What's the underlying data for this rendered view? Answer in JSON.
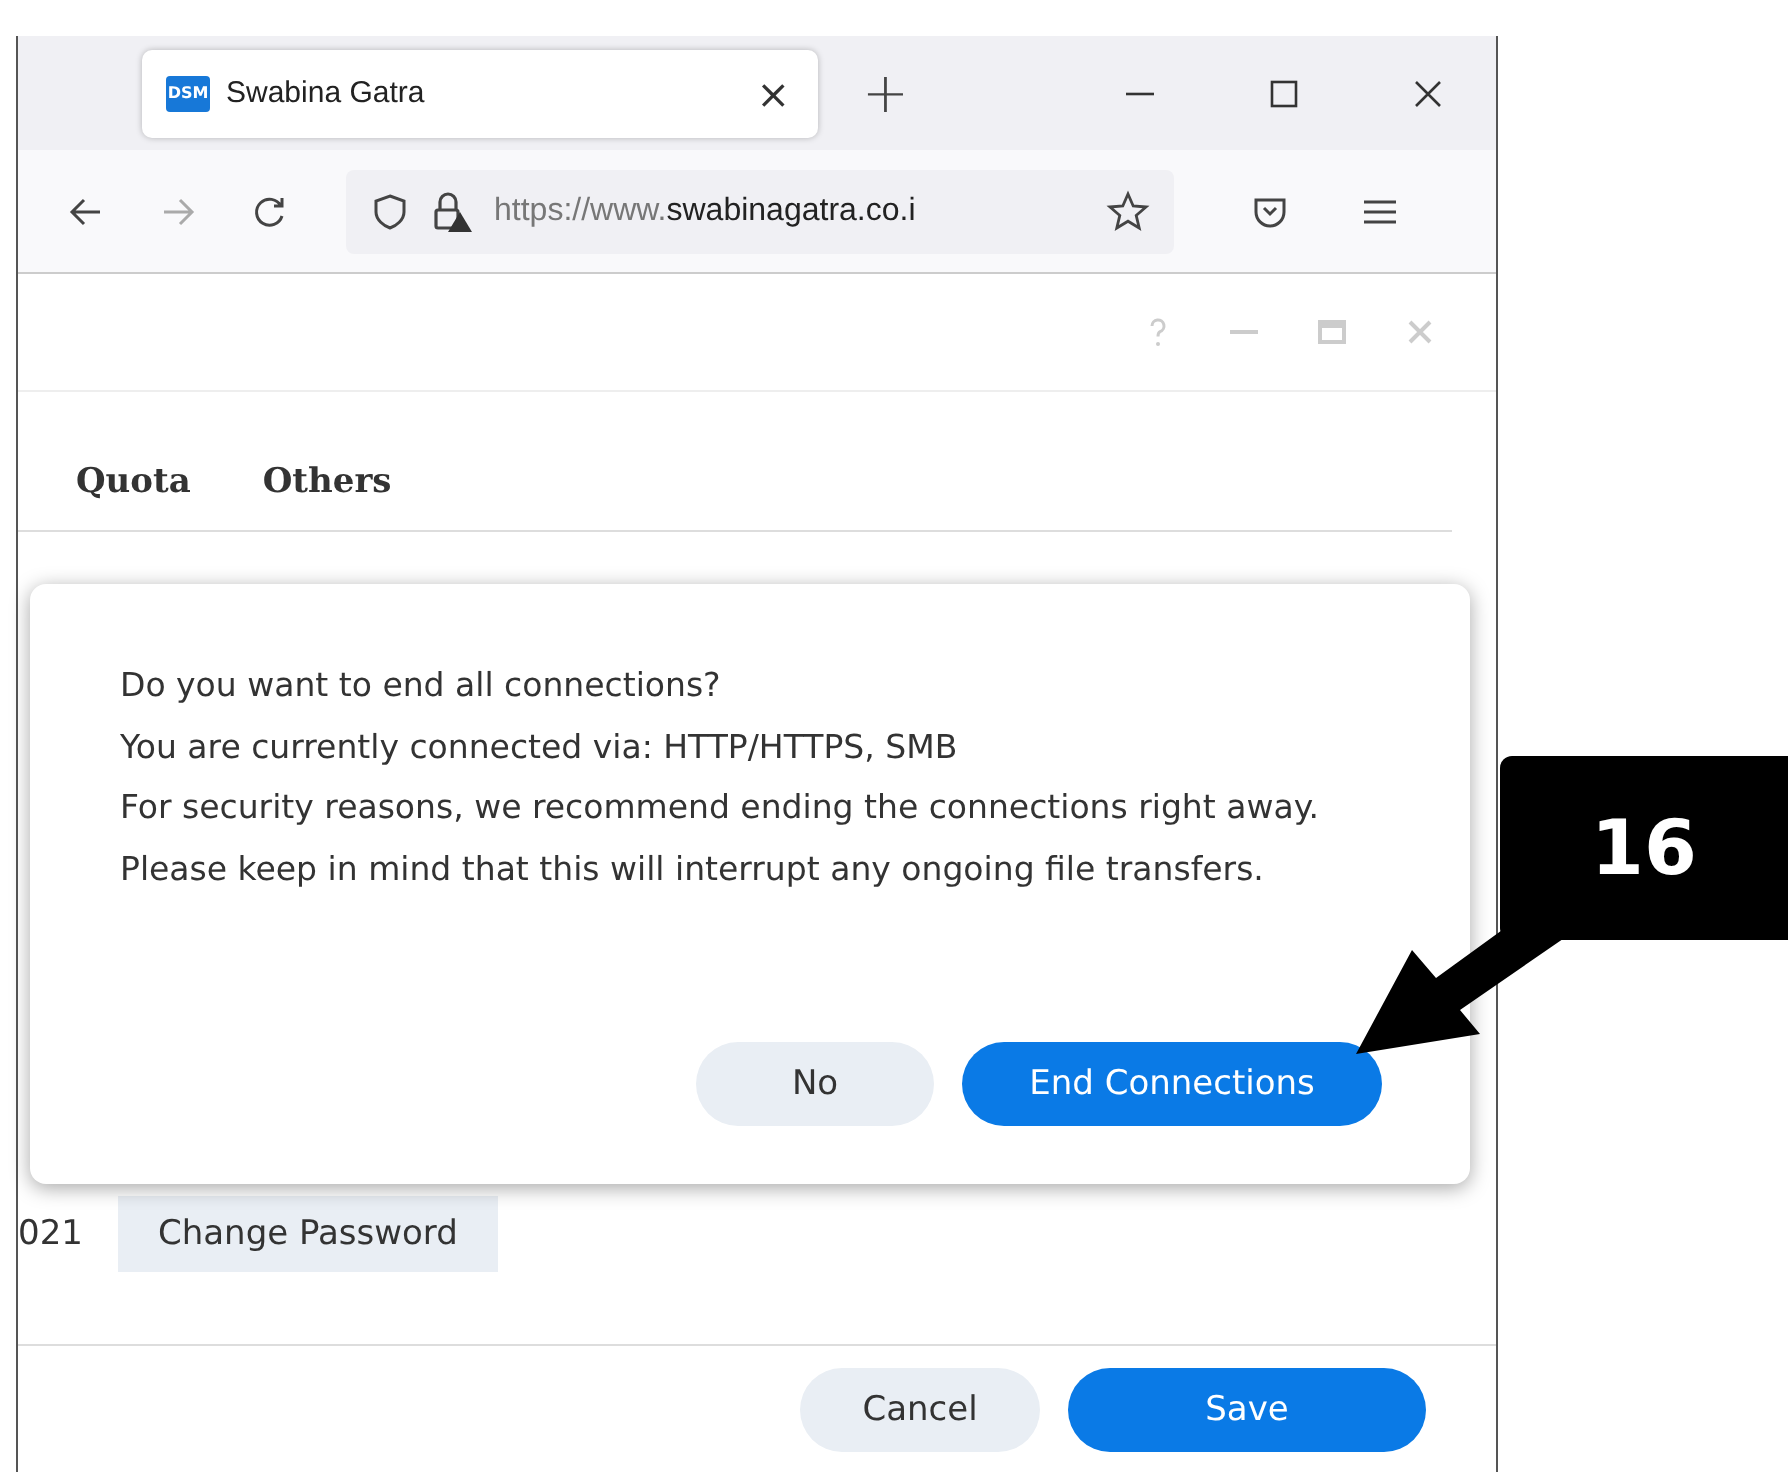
{
  "browser": {
    "tab": {
      "favicon": "DSM",
      "title": "Swabina Gatra",
      "close": "×"
    },
    "new_tab": "+",
    "url_scheme": "https://www.",
    "url_host": "swabinagatra.co.i"
  },
  "app_window": {
    "tabs": [
      {
        "label": "Quota"
      },
      {
        "label": "Others"
      }
    ],
    "date_fragment": "021",
    "change_password": "Change Password",
    "buttons": [
      {
        "label": "Cancel",
        "kind": "secondary"
      },
      {
        "label": "Save",
        "kind": "primary"
      }
    ]
  },
  "dialog": {
    "question": "Do you want to end all connections?",
    "connected": "You are currently connected via: HTTP/HTTPS, SMB",
    "message": "For security reasons, we recommend ending the connections right away. Please keep in mind that this will interrupt any ongoing file transfers.",
    "buttons": [
      {
        "label": "No",
        "kind": "secondary"
      },
      {
        "label": "End Connections",
        "kind": "primary"
      }
    ]
  },
  "callout": {
    "number": "16"
  }
}
